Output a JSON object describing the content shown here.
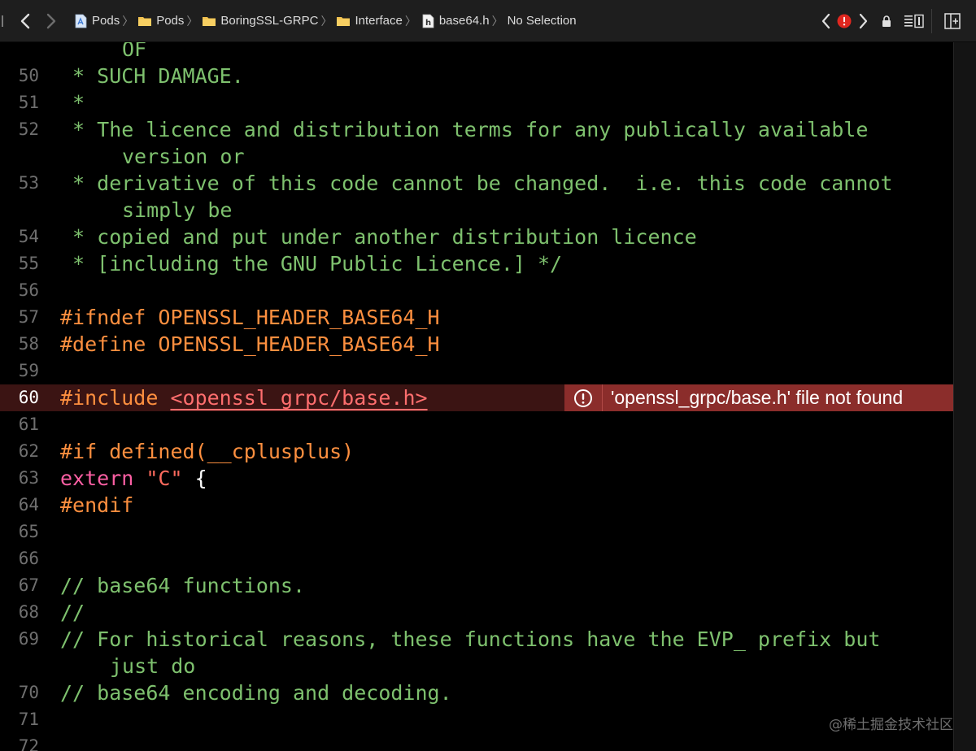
{
  "jumpbar": {
    "breadcrumbs": [
      {
        "label": "Pods",
        "icon": "project-icon"
      },
      {
        "label": "Pods",
        "icon": "folder-icon"
      },
      {
        "label": "BoringSSL-GRPC",
        "icon": "folder-icon"
      },
      {
        "label": "Interface",
        "icon": "folder-icon"
      },
      {
        "label": "base64.h",
        "icon": "header-file-icon"
      },
      {
        "label": "No Selection",
        "icon": ""
      }
    ],
    "error_color": "#e0271f"
  },
  "editor": {
    "lines": [
      {
        "num": "",
        "text": "OF"
      },
      {
        "num": "50",
        "text": " * SUCH DAMAGE."
      },
      {
        "num": "51",
        "text": " *"
      },
      {
        "num": "52",
        "text": " * The licence and distribution terms for any publically available",
        "wrap": "version or"
      },
      {
        "num": "53",
        "text": " * derivative of this code cannot be changed.  i.e. this code cannot",
        "wrap": "simply be"
      },
      {
        "num": "54",
        "text": " * copied and put under another distribution licence"
      },
      {
        "num": "55",
        "text": " * [including the GNU Public Licence.] */"
      },
      {
        "num": "56",
        "text": ""
      },
      {
        "num": "57",
        "text": "#ifndef OPENSSL_HEADER_BASE64_H"
      },
      {
        "num": "58",
        "text": "#define OPENSSL_HEADER_BASE64_H"
      },
      {
        "num": "59",
        "text": ""
      },
      {
        "num": "60",
        "directive": "#include ",
        "include": "<openssl_grpc/base.h>"
      },
      {
        "num": "61",
        "text": ""
      },
      {
        "num": "62",
        "text": "#if defined(__cplusplus)"
      },
      {
        "num": "63",
        "kw": "extern",
        "str": " \"C\"",
        "plain": " {"
      },
      {
        "num": "64",
        "text": "#endif"
      },
      {
        "num": "65",
        "text": ""
      },
      {
        "num": "66",
        "text": ""
      },
      {
        "num": "67",
        "text": "// base64 functions."
      },
      {
        "num": "68",
        "text": "//"
      },
      {
        "num": "69",
        "text": "// For historical reasons, these functions have the EVP_ prefix but",
        "wrap": "just do"
      },
      {
        "num": "70",
        "text": "// base64 encoding and decoding."
      },
      {
        "num": "71",
        "text": ""
      },
      {
        "num": "72",
        "text": ""
      }
    ],
    "error": {
      "message": "'openssl_grpc/base.h' file not found"
    }
  },
  "watermark": "@稀土掘金技术社区"
}
